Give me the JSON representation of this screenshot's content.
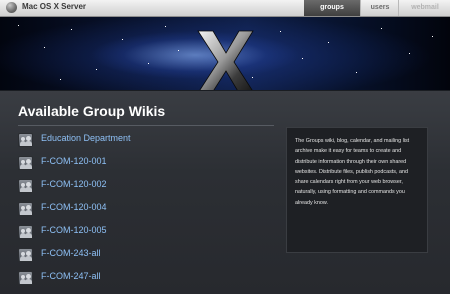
{
  "header": {
    "title": "Mac OS X Server",
    "nav": [
      {
        "label": "groups",
        "active": true
      },
      {
        "label": "users",
        "active": false
      },
      {
        "label": "webmail",
        "active": false
      }
    ]
  },
  "banner": {
    "mark_icon": "x-logo"
  },
  "main": {
    "heading": "Available Group Wikis",
    "groups": [
      {
        "label": "Education Department",
        "icon": "group-icon"
      },
      {
        "label": "F-COM-120-001",
        "icon": "group-icon"
      },
      {
        "label": "F-COM-120-002",
        "icon": "group-icon"
      },
      {
        "label": "F-COM-120-004",
        "icon": "group-icon"
      },
      {
        "label": "F-COM-120-005",
        "icon": "group-icon"
      },
      {
        "label": "F-COM-243-all",
        "icon": "group-icon"
      },
      {
        "label": "F-COM-247-all",
        "icon": "group-icon"
      }
    ]
  },
  "info": {
    "text": "The Groups wiki, blog, calendar, and mailing list archive make it easy for teams to create and distribute information through their own shared websites. Distribute files, publish podcasts, and share calendars right from your web browser, naturally, using formatting and commands you already know."
  },
  "colors": {
    "link": "#8ec0f5",
    "background": "#2b2e33",
    "nav_active": "#4f4f4f"
  }
}
